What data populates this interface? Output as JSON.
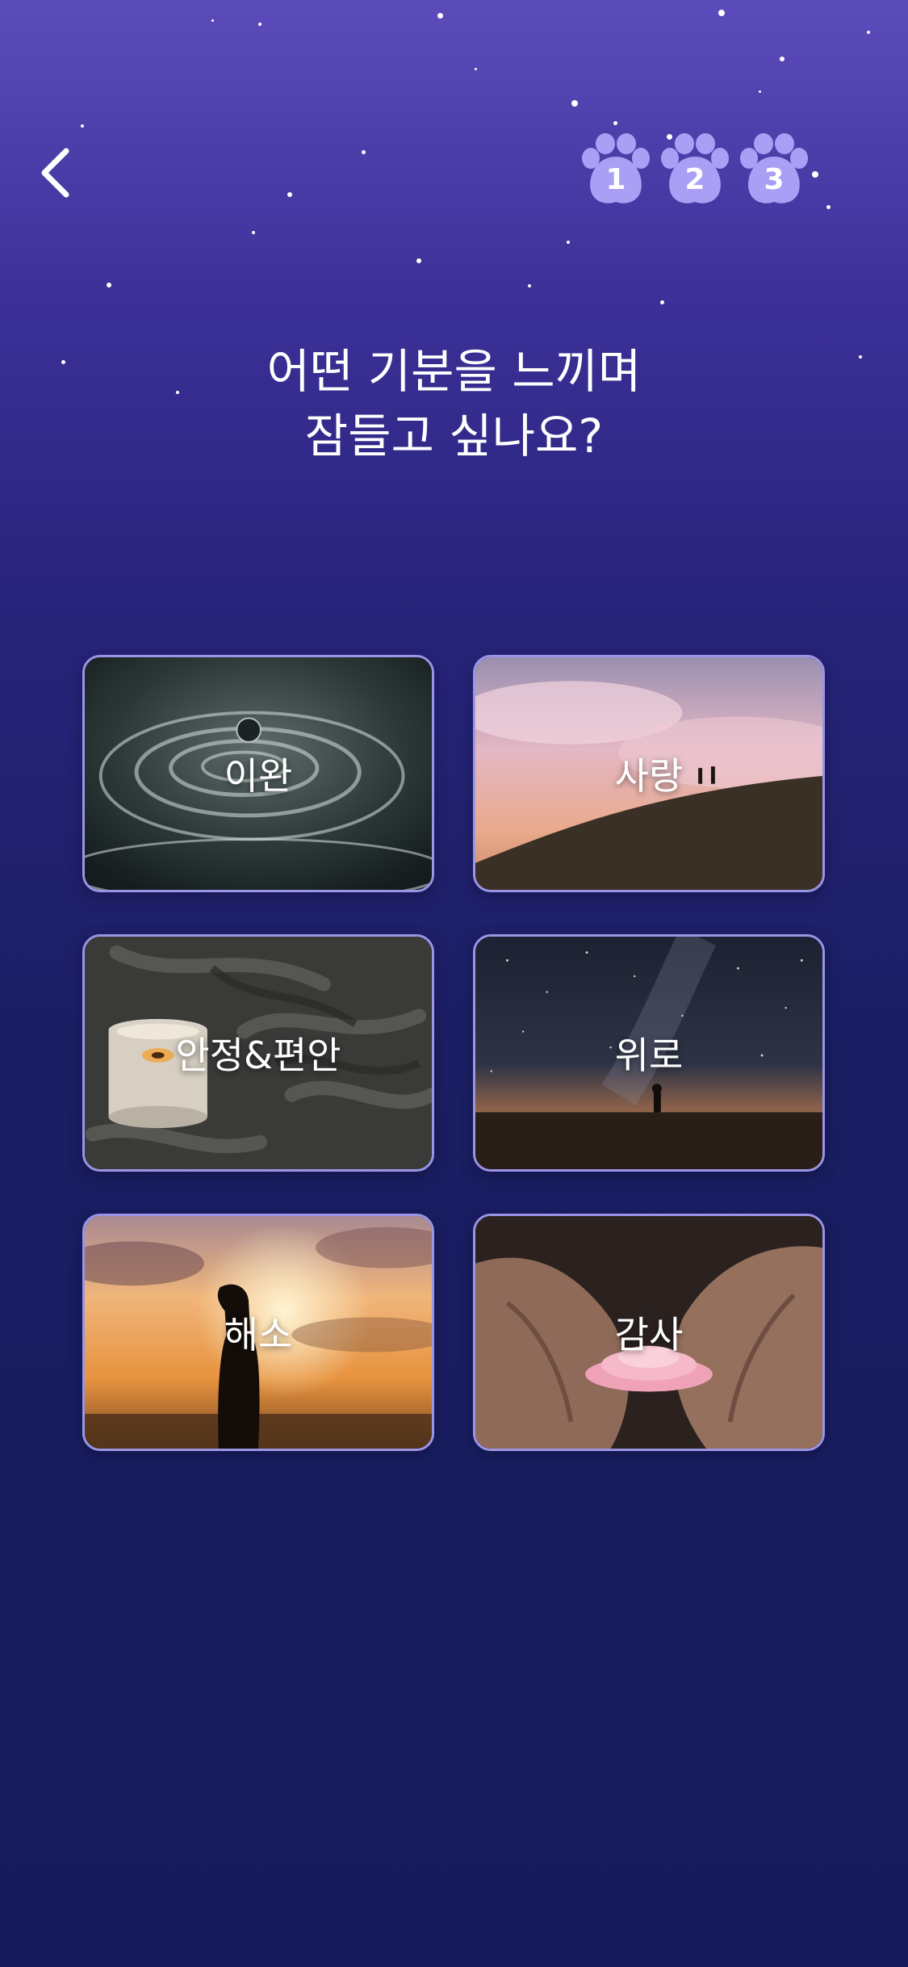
{
  "header": {
    "back_icon": "chevron-left-icon",
    "steps": [
      {
        "number": "1",
        "icon": "paw-icon"
      },
      {
        "number": "2",
        "icon": "paw-icon"
      },
      {
        "number": "3",
        "icon": "paw-icon"
      }
    ]
  },
  "question": {
    "line1": "어떤 기분을 느끼며",
    "line2": "잠들고 싶나요?"
  },
  "moods": [
    {
      "label": "이완"
    },
    {
      "label": "사랑"
    },
    {
      "label": "안정&편안"
    },
    {
      "label": "위로"
    },
    {
      "label": "해소"
    },
    {
      "label": "감사"
    }
  ],
  "colors": {
    "background_top": "#5c4cbb",
    "background_bottom": "#161b5c",
    "paw": "#a99ff5",
    "tile_border": "#9a95e6"
  }
}
